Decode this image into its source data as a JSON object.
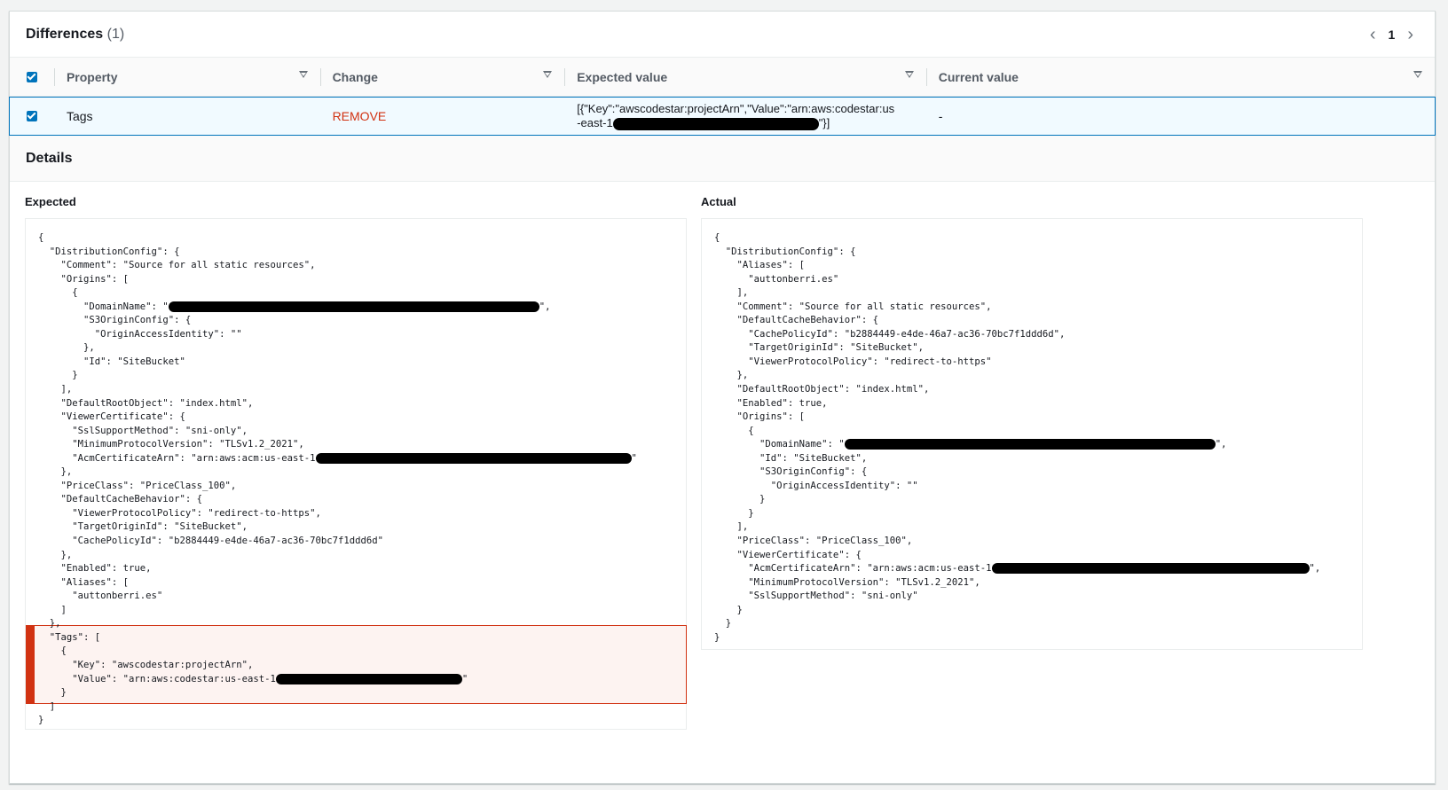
{
  "differences": {
    "title": "Differences",
    "count": "(1)",
    "page": "1",
    "columns": [
      "Property",
      "Change",
      "Expected value",
      "Current value"
    ],
    "row": {
      "property": "Tags",
      "change": "REMOVE",
      "expected_prefix": "[{\"Key\":\"awscodestar:projectArn\",\"Value\":\"arn:aws:codestar:us-east-1",
      "expected_suffix": "\"}]",
      "current": "-"
    }
  },
  "details": {
    "title": "Details",
    "expected_label": "Expected",
    "actual_label": "Actual",
    "expected_lines": [
      "{",
      "  \"DistributionConfig\": {",
      "    \"Comment\": \"Source for all static resources\",",
      "    \"Origins\": [",
      "      {",
      "        \"DomainName\": \"",
      "        \"S3OriginConfig\": {",
      "          \"OriginAccessIdentity\": \"\"",
      "        },",
      "        \"Id\": \"SiteBucket\"",
      "      }",
      "    ],",
      "    \"DefaultRootObject\": \"index.html\",",
      "    \"ViewerCertificate\": {",
      "      \"SslSupportMethod\": \"sni-only\",",
      "      \"MinimumProtocolVersion\": \"TLSv1.2_2021\",",
      "      \"AcmCertificateArn\": \"arn:aws:acm:us-east-1",
      "    },",
      "    \"PriceClass\": \"PriceClass_100\",",
      "    \"DefaultCacheBehavior\": {",
      "      \"ViewerProtocolPolicy\": \"redirect-to-https\",",
      "      \"TargetOriginId\": \"SiteBucket\",",
      "      \"CachePolicyId\": \"b2884449-e4de-46a7-ac36-70bc7f1ddd6d\"",
      "    },",
      "    \"Enabled\": true,",
      "    \"Aliases\": [",
      "      \"auttonberri.es\"",
      "    ]",
      "  },",
      "  \"Tags\": [",
      "    {",
      "      \"Key\": \"awscodestar:projectArn\",",
      "      \"Value\": \"arn:aws:codestar:us-east-1",
      "    }",
      "  ]",
      "}"
    ],
    "actual_lines": [
      "{",
      "  \"DistributionConfig\": {",
      "    \"Aliases\": [",
      "      \"auttonberri.es\"",
      "    ],",
      "    \"Comment\": \"Source for all static resources\",",
      "    \"DefaultCacheBehavior\": {",
      "      \"CachePolicyId\": \"b2884449-e4de-46a7-ac36-70bc7f1ddd6d\",",
      "      \"TargetOriginId\": \"SiteBucket\",",
      "      \"ViewerProtocolPolicy\": \"redirect-to-https\"",
      "    },",
      "    \"DefaultRootObject\": \"index.html\",",
      "    \"Enabled\": true,",
      "    \"Origins\": [",
      "      {",
      "        \"DomainName\": \"",
      "        \"Id\": \"SiteBucket\",",
      "        \"S3OriginConfig\": {",
      "          \"OriginAccessIdentity\": \"\"",
      "        }",
      "      }",
      "    ],",
      "    \"PriceClass\": \"PriceClass_100\",",
      "    \"ViewerCertificate\": {",
      "      \"AcmCertificateArn\": \"arn:aws:acm:us-east-1",
      "      \"MinimumProtocolVersion\": \"TLSv1.2_2021\",",
      "      \"SslSupportMethod\": \"sni-only\"",
      "    }",
      "  }",
      "}"
    ],
    "expected_redactions": [
      {
        "line": 5,
        "suffix": "\","
      },
      {
        "line": 16,
        "suffix": "\""
      },
      {
        "line": 32,
        "suffix": "\""
      }
    ],
    "actual_redactions": [
      {
        "line": 15,
        "suffix": "\","
      },
      {
        "line": 24,
        "suffix": "\","
      }
    ]
  },
  "colors": {
    "accent": "#0073bb",
    "remove": "#d13212",
    "diff_bg": "#fdf3f1"
  },
  "icons": [
    "chevron-left-icon",
    "chevron-right-icon",
    "sort-caret-icon",
    "checkbox-checked-icon"
  ]
}
